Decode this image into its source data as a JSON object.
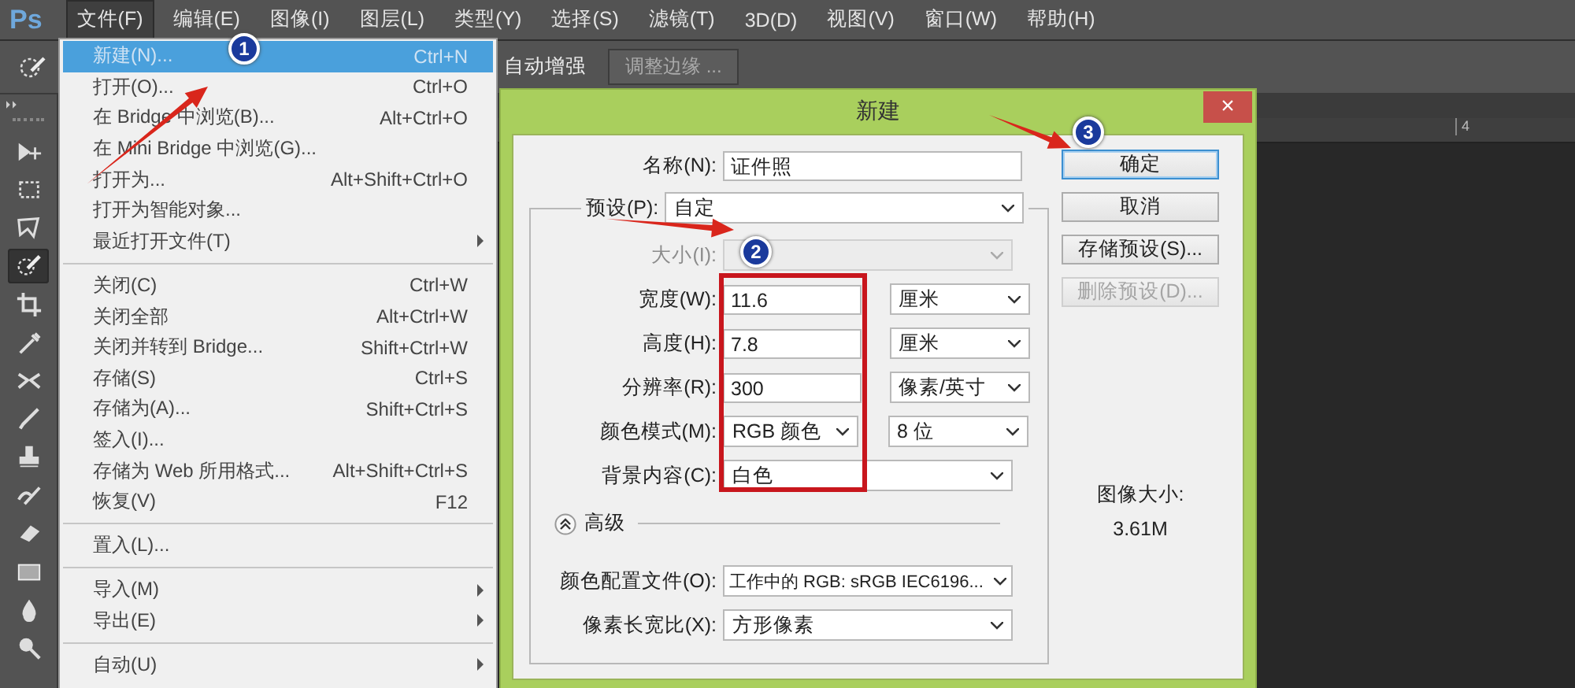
{
  "app_logo": "Ps",
  "menubar": [
    {
      "label": "文件(F)",
      "selected": true
    },
    {
      "label": "编辑(E)",
      "selected": false
    },
    {
      "label": "图像(I)",
      "selected": false
    },
    {
      "label": "图层(L)",
      "selected": false
    },
    {
      "label": "类型(Y)",
      "selected": false
    },
    {
      "label": "选择(S)",
      "selected": false
    },
    {
      "label": "滤镜(T)",
      "selected": false
    },
    {
      "label": "3D(D)",
      "selected": false
    },
    {
      "label": "视图(V)",
      "selected": false
    },
    {
      "label": "窗口(W)",
      "selected": false
    },
    {
      "label": "帮助(H)",
      "selected": false
    }
  ],
  "options_bar": {
    "auto_enhance": "自动增强",
    "refine_edge_button": "调整边缘 ..."
  },
  "toolbar": {
    "tools": [
      {
        "kind": "move",
        "selected": false
      },
      {
        "kind": "marquee",
        "selected": false
      },
      {
        "kind": "lasso",
        "selected": false
      },
      {
        "kind": "quick-select",
        "selected": true
      },
      {
        "kind": "crop",
        "selected": false
      },
      {
        "kind": "eyedropper",
        "selected": false
      },
      {
        "kind": "healing",
        "selected": false
      },
      {
        "kind": "brush",
        "selected": false
      },
      {
        "kind": "stamp",
        "selected": false
      },
      {
        "kind": "history-brush",
        "selected": false
      },
      {
        "kind": "eraser",
        "selected": false
      },
      {
        "kind": "gradient",
        "selected": false
      },
      {
        "kind": "blur",
        "selected": false
      },
      {
        "kind": "dodge",
        "selected": false
      }
    ]
  },
  "file_menu": {
    "items": [
      {
        "kind": "item",
        "label": "新建(N)...",
        "shortcut": "Ctrl+N",
        "selected": true,
        "submenu": false
      },
      {
        "kind": "item",
        "label": "打开(O)...",
        "shortcut": "Ctrl+O",
        "selected": false,
        "submenu": false
      },
      {
        "kind": "item",
        "label": "在 Bridge 中浏览(B)...",
        "shortcut": "Alt+Ctrl+O",
        "selected": false,
        "submenu": false
      },
      {
        "kind": "item",
        "label": "在 Mini Bridge 中浏览(G)...",
        "selected": false,
        "submenu": false
      },
      {
        "kind": "item",
        "label": "打开为...",
        "shortcut": "Alt+Shift+Ctrl+O",
        "selected": false,
        "submenu": false
      },
      {
        "kind": "item",
        "label": "打开为智能对象...",
        "selected": false,
        "submenu": false
      },
      {
        "kind": "item",
        "label": "最近打开文件(T)",
        "selected": false,
        "submenu": true
      },
      {
        "kind": "separator"
      },
      {
        "kind": "item",
        "label": "关闭(C)",
        "shortcut": "Ctrl+W",
        "selected": false,
        "submenu": false
      },
      {
        "kind": "item",
        "label": "关闭全部",
        "shortcut": "Alt+Ctrl+W",
        "selected": false,
        "submenu": false
      },
      {
        "kind": "item",
        "label": "关闭并转到 Bridge...",
        "shortcut": "Shift+Ctrl+W",
        "selected": false,
        "submenu": false
      },
      {
        "kind": "item",
        "label": "存储(S)",
        "shortcut": "Ctrl+S",
        "selected": false,
        "submenu": false
      },
      {
        "kind": "item",
        "label": "存储为(A)...",
        "shortcut": "Shift+Ctrl+S",
        "selected": false,
        "submenu": false
      },
      {
        "kind": "item",
        "label": "签入(I)...",
        "selected": false,
        "submenu": false
      },
      {
        "kind": "item",
        "label": "存储为 Web 所用格式...",
        "shortcut": "Alt+Shift+Ctrl+S",
        "selected": false,
        "submenu": false
      },
      {
        "kind": "item",
        "label": "恢复(V)",
        "shortcut": "F12",
        "selected": false,
        "submenu": false
      },
      {
        "kind": "separator"
      },
      {
        "kind": "item",
        "label": "置入(L)...",
        "selected": false,
        "submenu": false
      },
      {
        "kind": "separator"
      },
      {
        "kind": "item",
        "label": "导入(M)",
        "selected": false,
        "submenu": true
      },
      {
        "kind": "item",
        "label": "导出(E)",
        "selected": false,
        "submenu": true
      },
      {
        "kind": "separator"
      },
      {
        "kind": "item",
        "label": "自动(U)",
        "selected": false,
        "submenu": true
      }
    ]
  },
  "document": {
    "ruler_label": "4"
  },
  "dialog": {
    "title": "新建",
    "close": "×",
    "name": {
      "label": "名称(N):",
      "value": "证件照"
    },
    "preset": {
      "label": "预设(P):",
      "value": "自定"
    },
    "size": {
      "label": "大小(I):",
      "disabled": true
    },
    "rows": [
      {
        "kind": "measure",
        "label": "宽度(W):",
        "value": "11.6",
        "unit": "厘米"
      },
      {
        "kind": "measure",
        "label": "高度(H):",
        "value": "7.8",
        "unit": "厘米"
      },
      {
        "kind": "measure",
        "label": "分辨率(R):",
        "value": "300",
        "unit": "像素/英寸"
      },
      {
        "kind": "mode",
        "label": "颜色模式(M):",
        "value": "RGB 颜色",
        "unit": "8 位"
      },
      {
        "kind": "select",
        "label": "背景内容(C):",
        "value": "白色"
      }
    ],
    "advanced": {
      "label": "高级",
      "expanded": true
    },
    "advanced_rows": [
      {
        "label": "颜色配置文件(O):",
        "value": "工作中的 RGB: sRGB IEC6196..."
      },
      {
        "label": "像素长宽比(X):",
        "value": "方形像素"
      }
    ],
    "buttons": [
      {
        "label": "确定",
        "default": true,
        "disabled": false
      },
      {
        "label": "取消",
        "default": false,
        "disabled": false
      },
      {
        "label": "存储预设(S)...",
        "default": false,
        "disabled": false
      },
      {
        "label": "删除预设(D)...",
        "default": false,
        "disabled": true
      }
    ],
    "image_size": {
      "label": "图像大小:",
      "value": "3.61M"
    }
  },
  "annotations": {
    "badges": [
      "1",
      "2",
      "3"
    ]
  }
}
